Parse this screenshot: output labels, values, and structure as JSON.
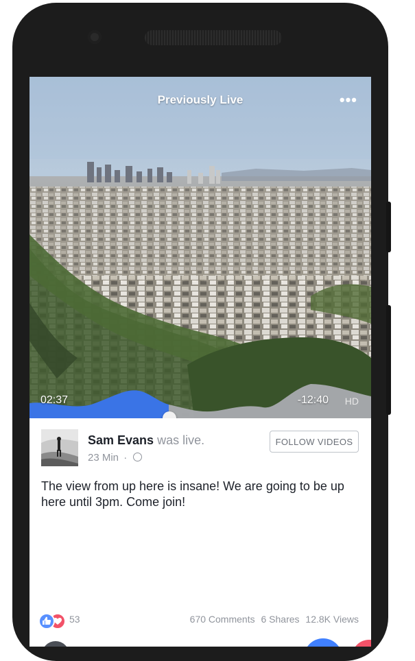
{
  "video": {
    "title": "Previously Live",
    "more_label": "•••",
    "elapsed": "02:37",
    "remaining": "-12:40",
    "quality": "HD",
    "progress_fraction": 0.41
  },
  "post": {
    "author_name": "Sam Evans",
    "author_suffix": "was live.",
    "time": "23 Min",
    "separator": "·",
    "follow_label": "FOLLOW VIDEOS",
    "message": "The view from up here is insane! We are going to be up here until 3pm. Come join!"
  },
  "stats": {
    "reaction_count": "53",
    "comments": "670 Comments",
    "shares": "6 Shares",
    "views": "12.8K Views"
  },
  "colors": {
    "accent": "#4080ff",
    "love": "#f25268",
    "text": "#1d2129",
    "muted": "#90949c"
  }
}
